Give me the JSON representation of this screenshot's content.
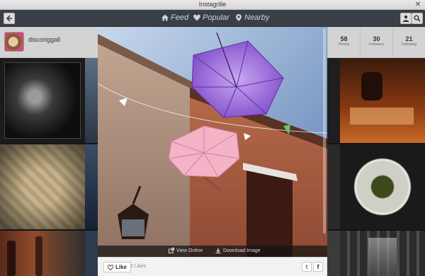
{
  "window": {
    "title": "Instagrille",
    "close_glyph": "✕"
  },
  "toolbar": {
    "back_icon": "arrow-left-icon",
    "nav": [
      {
        "label": "Feed",
        "icon": "home-icon"
      },
      {
        "label": "Popular",
        "icon": "heart-icon"
      },
      {
        "label": "Nearby",
        "icon": "map-pin-icon"
      }
    ],
    "user_icon": "user-icon",
    "search_icon": "search-icon"
  },
  "profile": {
    "username": "discoriggall"
  },
  "stats": [
    {
      "value": "58",
      "label": "Photos"
    },
    {
      "value": "30",
      "label": "Followers"
    },
    {
      "value": "21",
      "label": "Following"
    }
  ],
  "photo_actions": {
    "view_online": "View Online",
    "download": "Download Image"
  },
  "like_bar": {
    "like_label": "Like",
    "likes_count": "2 Likes",
    "twitter": "t",
    "facebook": "f"
  },
  "colors": {
    "toolbar": "#3a3f47",
    "profile_bg": "#d3d3d3",
    "accent_purple": "#9b6bdc",
    "accent_pink": "#f3a9c0"
  }
}
